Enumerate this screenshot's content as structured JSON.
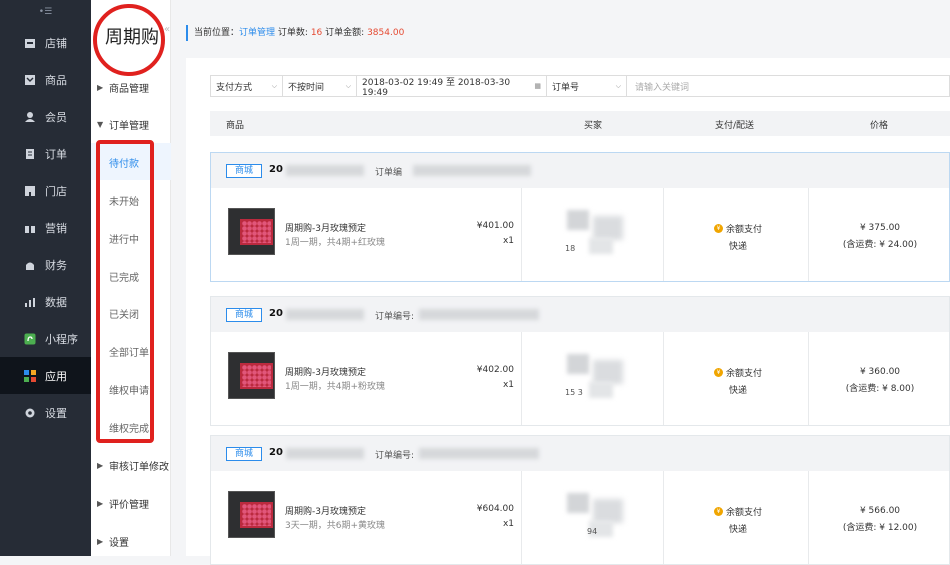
{
  "nav": {
    "top_mark": "•☰",
    "items": [
      {
        "label": "店铺",
        "icon": "store-icon"
      },
      {
        "label": "商品",
        "icon": "goods-icon"
      },
      {
        "label": "会员",
        "icon": "member-icon"
      },
      {
        "label": "订单",
        "icon": "order-icon"
      },
      {
        "label": "门店",
        "icon": "shop-icon"
      },
      {
        "label": "营销",
        "icon": "gift-icon"
      },
      {
        "label": "财务",
        "icon": "finance-icon"
      },
      {
        "label": "数据",
        "icon": "chart-icon"
      },
      {
        "label": "小程序",
        "icon": "miniprogram-icon"
      },
      {
        "label": "应用",
        "icon": "apps-icon"
      },
      {
        "label": "设置",
        "icon": "gear-icon"
      }
    ],
    "active_index": 9
  },
  "subnav": {
    "brand": "周期购",
    "collapse": "«",
    "groups": [
      "商品管理",
      "订单管理",
      "审核订单修改",
      "评价管理",
      "设置"
    ],
    "order_items": [
      "待付款",
      "未开始",
      "进行中",
      "已完成",
      "已关闭",
      "全部订单",
      "维权申请",
      "维权完成"
    ]
  },
  "breadcrumb": {
    "prefix": "当前位置：",
    "page": "订单管理",
    "count_label": "订单数:",
    "count": "16",
    "amount_label": "订单金额:",
    "amount": "3854.00"
  },
  "filters": {
    "pay_method": "支付方式",
    "time_type": "不按时间",
    "date_range": "2018-03-02 19:49 至 2018-03-30 19:49",
    "field": "订单号",
    "search_placeholder": "请输入关键词"
  },
  "columns": {
    "goods": "商品",
    "buyer": "买家",
    "pay_ship": "支付/配送",
    "price": "价格"
  },
  "orders": [
    {
      "tag": "商城",
      "id_prefix": "20",
      "id_label": "订单编",
      "product_name": "周期购-3月玫瑰预定",
      "product_desc": "1周一期，共4期+红玫瑰",
      "unit_price": "¥401.00",
      "qty": "x1",
      "buyer_phone": "18",
      "payment": "余额支付",
      "shipping": "快递",
      "price": "¥ 375.00",
      "shipping_fee": "(含运费: ¥ 24.00)"
    },
    {
      "tag": "商城",
      "id_prefix": "20",
      "id_label": "订单编号:",
      "product_name": "周期购-3月玫瑰预定",
      "product_desc": "1周一期，共4期+粉玫瑰",
      "unit_price": "¥402.00",
      "qty": "x1",
      "buyer_phone": "15          3",
      "payment": "余额支付",
      "shipping": "快递",
      "price": "¥ 360.00",
      "shipping_fee": "(含运费: ¥ 8.00)"
    },
    {
      "tag": "商城",
      "id_prefix": "20",
      "id_label": "订单编号:",
      "product_name": "周期购-3月玫瑰预定",
      "product_desc": "3天一期，共6期+黄玫瑰",
      "unit_price": "¥604.00",
      "qty": "x1",
      "buyer_phone": "94",
      "payment": "余额支付",
      "shipping": "快递",
      "price": "¥ 566.00",
      "shipping_fee": "(含运费: ¥ 12.00)"
    }
  ]
}
